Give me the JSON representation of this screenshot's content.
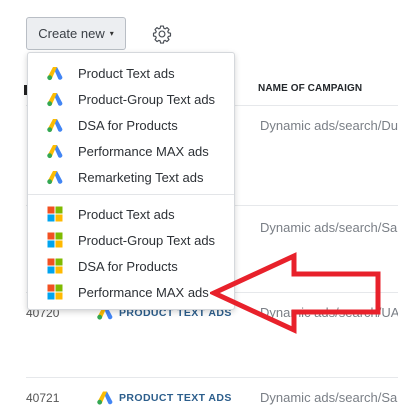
{
  "toolbar": {
    "create_label": "Create new",
    "caret": "▾",
    "settings_icon": "gear-icon"
  },
  "table": {
    "header": "NAME OF CAMPAIGN",
    "rows": [
      {
        "id": "",
        "type": "",
        "campaign": "Dynamic ads/search/Du"
      },
      {
        "id": "",
        "type": "",
        "campaign": "Dynamic ads/search/Sa"
      },
      {
        "id": "40720",
        "type": "PRODUCT TEXT ADS",
        "campaign": "Dynamic ads/search/UA"
      },
      {
        "id": "40721",
        "type": "PRODUCT TEXT ADS",
        "campaign": "Dynamic ads/search/Sa"
      }
    ]
  },
  "menu": {
    "google_items": [
      {
        "label": "Product Text ads",
        "icon": "google-ads-icon"
      },
      {
        "label": "Product-Group Text ads",
        "icon": "google-ads-icon"
      },
      {
        "label": "DSA for Products",
        "icon": "google-ads-icon"
      },
      {
        "label": "Performance MAX ads",
        "icon": "google-ads-icon"
      },
      {
        "label": "Remarketing Text ads",
        "icon": "google-ads-icon"
      }
    ],
    "microsoft_items": [
      {
        "label": "Product Text ads",
        "icon": "microsoft-icon"
      },
      {
        "label": "Product-Group Text ads",
        "icon": "microsoft-icon"
      },
      {
        "label": "DSA for Products",
        "icon": "microsoft-icon"
      },
      {
        "label": "Performance MAX ads",
        "icon": "microsoft-icon"
      }
    ]
  },
  "colors": {
    "google_blue": "#4285F4",
    "google_yellow": "#FBBC04",
    "google_green": "#34A853",
    "ms_red": "#F25022",
    "ms_green": "#7FBA00",
    "ms_blue": "#00A4EF",
    "ms_yellow": "#FFB900",
    "arrow_red": "#E8212B"
  }
}
